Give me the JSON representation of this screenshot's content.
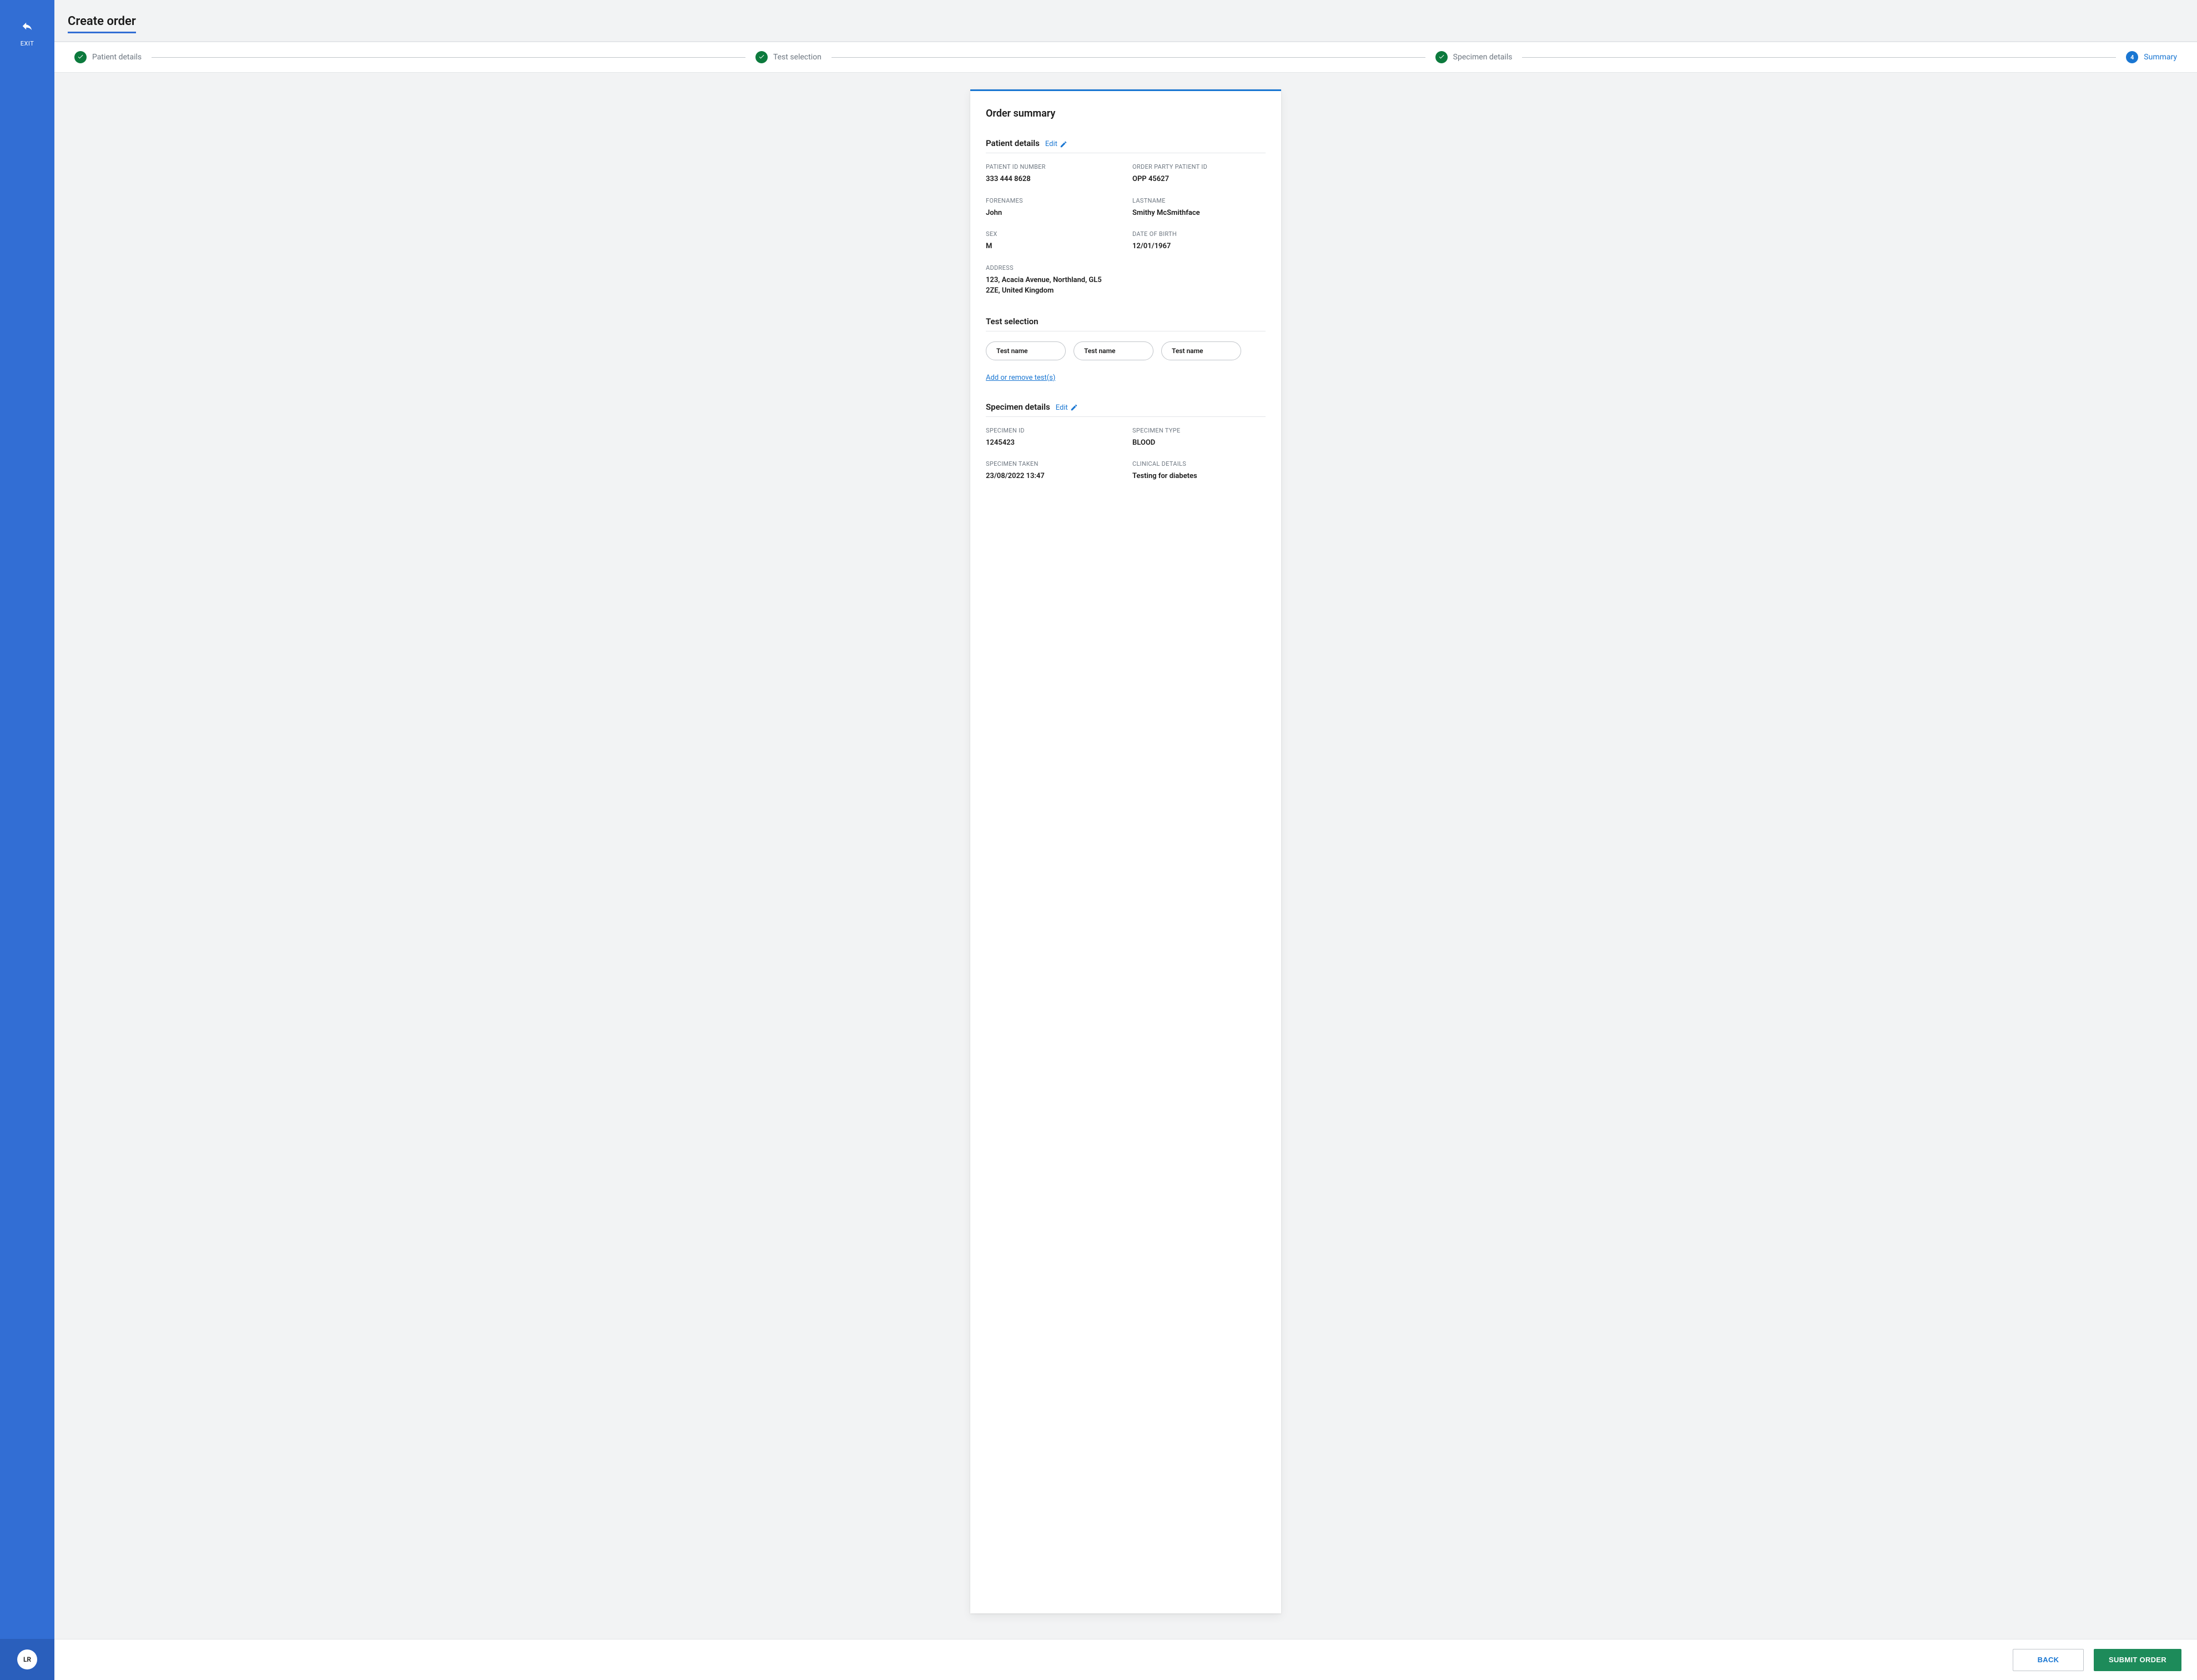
{
  "sidebar": {
    "exit_label": "EXIT",
    "avatar_initials": "LR"
  },
  "header": {
    "title": "Create order"
  },
  "stepper": {
    "steps": [
      {
        "label": "Patient details",
        "state": "done"
      },
      {
        "label": "Test selection",
        "state": "done"
      },
      {
        "label": "Specimen details",
        "state": "done"
      },
      {
        "label": "Summary",
        "state": "active",
        "number": "4"
      }
    ]
  },
  "summary": {
    "card_title": "Order summary",
    "patient_section": {
      "title": "Patient details",
      "edit_label": "Edit",
      "fields": {
        "patient_id_number": {
          "label": "PATIENT ID NUMBER",
          "value": "333 444 8628"
        },
        "order_party_patient_id": {
          "label": "ORDER PARTY PATIENT ID",
          "value": "OPP 45627"
        },
        "forenames": {
          "label": "FORENAMES",
          "value": "John"
        },
        "lastname": {
          "label": "LASTNAME",
          "value": "Smithy McSmithface"
        },
        "sex": {
          "label": "SEX",
          "value": "M"
        },
        "dob": {
          "label": "DATE OF BIRTH",
          "value": "12/01/1967"
        },
        "address": {
          "label": "ADDRESS",
          "value": "123, Acacia Avenue, Northland, GL5 2ZE, United Kingdom"
        }
      }
    },
    "test_section": {
      "title": "Test selection",
      "tests": [
        "Test name",
        "Test name",
        "Test name"
      ],
      "add_remove_label": "Add or remove test(s)"
    },
    "specimen_section": {
      "title": "Specimen details",
      "edit_label": "Edit",
      "fields": {
        "specimen_id": {
          "label": "SPECIMEN ID",
          "value": "1245423"
        },
        "specimen_type": {
          "label": "SPECIMEN TYPE",
          "value": "BLOOD"
        },
        "specimen_taken": {
          "label": "SPECIMEN TAKEN",
          "value": "23/08/2022 13:47"
        },
        "clinical_details": {
          "label": "CLINICAL DETAILS",
          "value": "Testing for diabetes"
        }
      }
    }
  },
  "footer": {
    "back_label": "BACK",
    "submit_label": "SUBMIT ORDER"
  },
  "colors": {
    "brand_blue": "#326ed4",
    "accent_blue": "#1976d2",
    "success_green": "#0c7a3d",
    "action_green": "#1d8b5a"
  }
}
